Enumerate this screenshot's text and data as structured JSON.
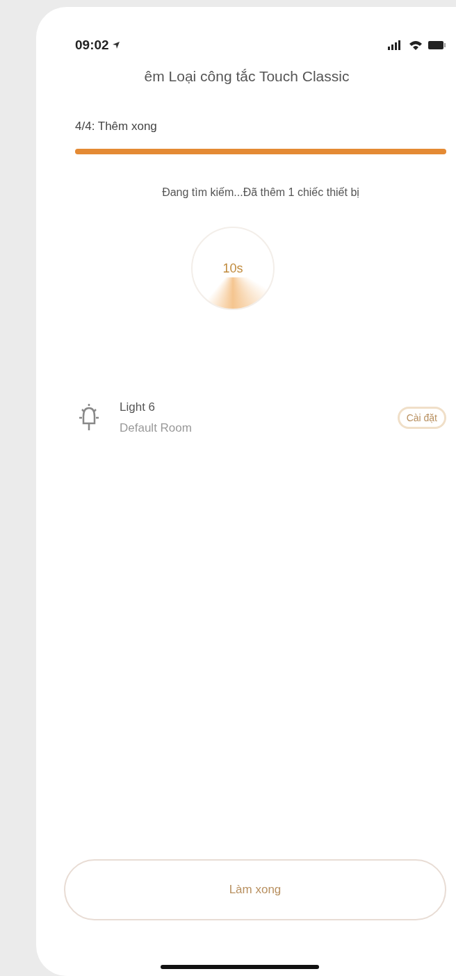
{
  "status_bar": {
    "time": "09:02"
  },
  "header": {
    "title": "êm Loại công tắc Touch Classic"
  },
  "step": {
    "label": "4/4: Thêm xong",
    "level": 1
  },
  "search_status": "Đang tìm kiếm...Đã thêm 1 chiếc thiết bị",
  "timer": {
    "label": "10s"
  },
  "devices": [
    {
      "name": "Light 6",
      "room": "Default Room",
      "action": "Cài đặt"
    }
  ],
  "done_button": "Làm xong"
}
